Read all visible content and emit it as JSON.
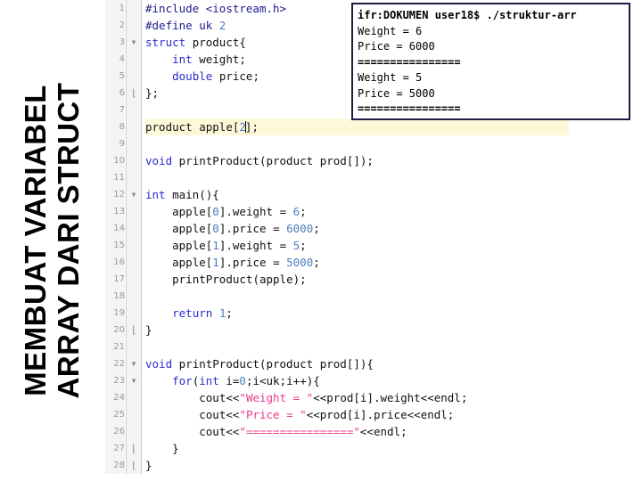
{
  "slide": {
    "title": "MEMBUAT VARIABEL\nARRAY DARI STRUCT"
  },
  "editor": {
    "current_line": 8,
    "cursor_after": "2",
    "colors": {
      "preprocessor": "#1a1a8c",
      "keyword": "#2b2bd0",
      "number": "#4f7fbf",
      "string": "#ea3a8e",
      "plain": "#111111",
      "gutter_bg": "#f4f4f4",
      "gutter_text": "#9a9a9a",
      "current_line_bg": "#fdf9d8"
    },
    "lines": [
      {
        "n": "1",
        "fold": "",
        "code": "#include <iostream.h>"
      },
      {
        "n": "2",
        "fold": "",
        "code": "#define uk 2"
      },
      {
        "n": "3",
        "fold": "open",
        "code": "struct product{"
      },
      {
        "n": "4",
        "fold": "",
        "code": "    int weight;"
      },
      {
        "n": "5",
        "fold": "",
        "code": "    double price;"
      },
      {
        "n": "6",
        "fold": "close",
        "code": "};"
      },
      {
        "n": "7",
        "fold": "",
        "code": ""
      },
      {
        "n": "8",
        "fold": "",
        "code": "product apple[2];"
      },
      {
        "n": "9",
        "fold": "",
        "code": ""
      },
      {
        "n": "10",
        "fold": "",
        "code": "void printProduct(product prod[]);"
      },
      {
        "n": "11",
        "fold": "",
        "code": ""
      },
      {
        "n": "12",
        "fold": "open",
        "code": "int main(){"
      },
      {
        "n": "13",
        "fold": "",
        "code": "    apple[0].weight = 6;"
      },
      {
        "n": "14",
        "fold": "",
        "code": "    apple[0].price = 6000;"
      },
      {
        "n": "15",
        "fold": "",
        "code": "    apple[1].weight = 5;"
      },
      {
        "n": "16",
        "fold": "",
        "code": "    apple[1].price = 5000;"
      },
      {
        "n": "17",
        "fold": "",
        "code": "    printProduct(apple);"
      },
      {
        "n": "18",
        "fold": "",
        "code": ""
      },
      {
        "n": "19",
        "fold": "",
        "code": "    return 1;"
      },
      {
        "n": "20",
        "fold": "close",
        "code": "}"
      },
      {
        "n": "21",
        "fold": "",
        "code": ""
      },
      {
        "n": "22",
        "fold": "open",
        "code": "void printProduct(product prod[]){"
      },
      {
        "n": "23",
        "fold": "open",
        "code": "    for(int i=0;i<uk;i++){"
      },
      {
        "n": "24",
        "fold": "",
        "code": "        cout<<\"Weight = \"<<prod[i].weight<<endl;"
      },
      {
        "n": "25",
        "fold": "",
        "code": "        cout<<\"Price = \"<<prod[i].price<<endl;"
      },
      {
        "n": "26",
        "fold": "",
        "code": "        cout<<\"================\"<<endl;"
      },
      {
        "n": "27",
        "fold": "close",
        "code": "    }"
      },
      {
        "n": "28",
        "fold": "close",
        "code": "}"
      }
    ]
  },
  "terminal": {
    "lines": [
      {
        "text": "ifr:DOKUMEN user18$ ./struktur-arr",
        "bold": true
      },
      {
        "text": "Weight = 6",
        "bold": false
      },
      {
        "text": "Price = 6000",
        "bold": false
      },
      {
        "text": "================",
        "bold": true
      },
      {
        "text": "Weight = 5",
        "bold": false
      },
      {
        "text": "Price = 5000",
        "bold": false
      },
      {
        "text": "================",
        "bold": true
      }
    ]
  }
}
